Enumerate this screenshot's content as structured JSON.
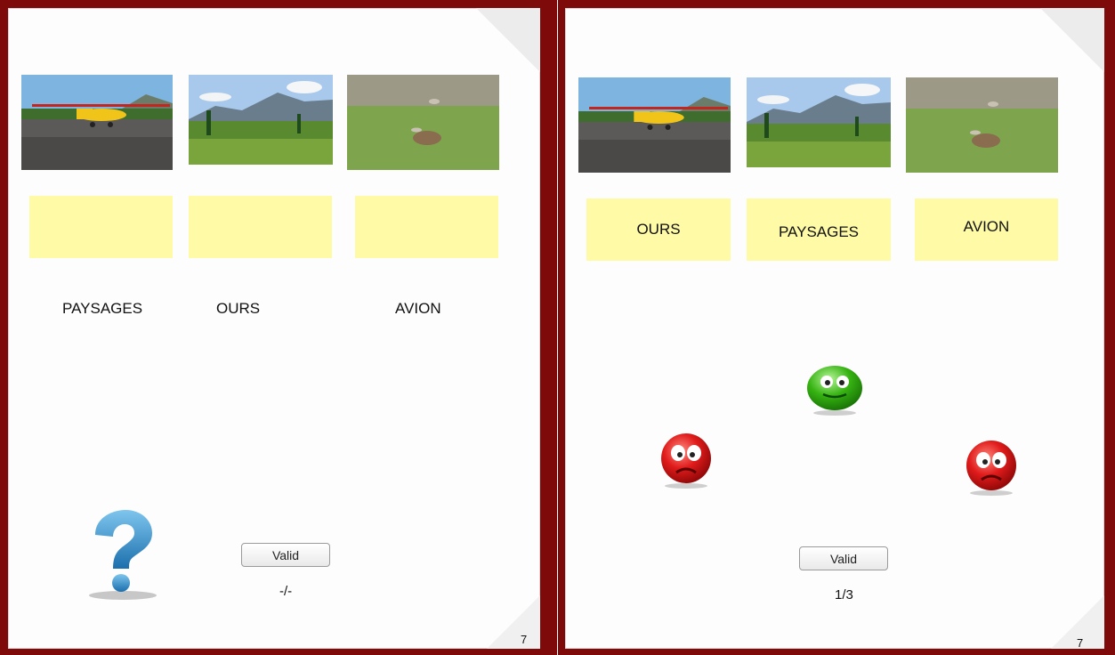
{
  "left_page": {
    "labels": [
      "PAYSAGES",
      "OURS",
      "AVION"
    ],
    "button": "Valid",
    "score": "-/-",
    "page_number": "7"
  },
  "right_page": {
    "placed": [
      "OURS",
      "PAYSAGES",
      "AVION"
    ],
    "button": "Valid",
    "score": "1/3",
    "page_number": "7",
    "results": [
      "wrong",
      "correct",
      "wrong"
    ]
  },
  "images": [
    "airplane-photo",
    "landscape-photo",
    "bear-photo"
  ],
  "colors": {
    "frame": "#7e0a0a",
    "dropbox": "#fefaa6",
    "correct": "#3cb80f",
    "wrong": "#d10f0f",
    "help": "#2f8fcc"
  }
}
